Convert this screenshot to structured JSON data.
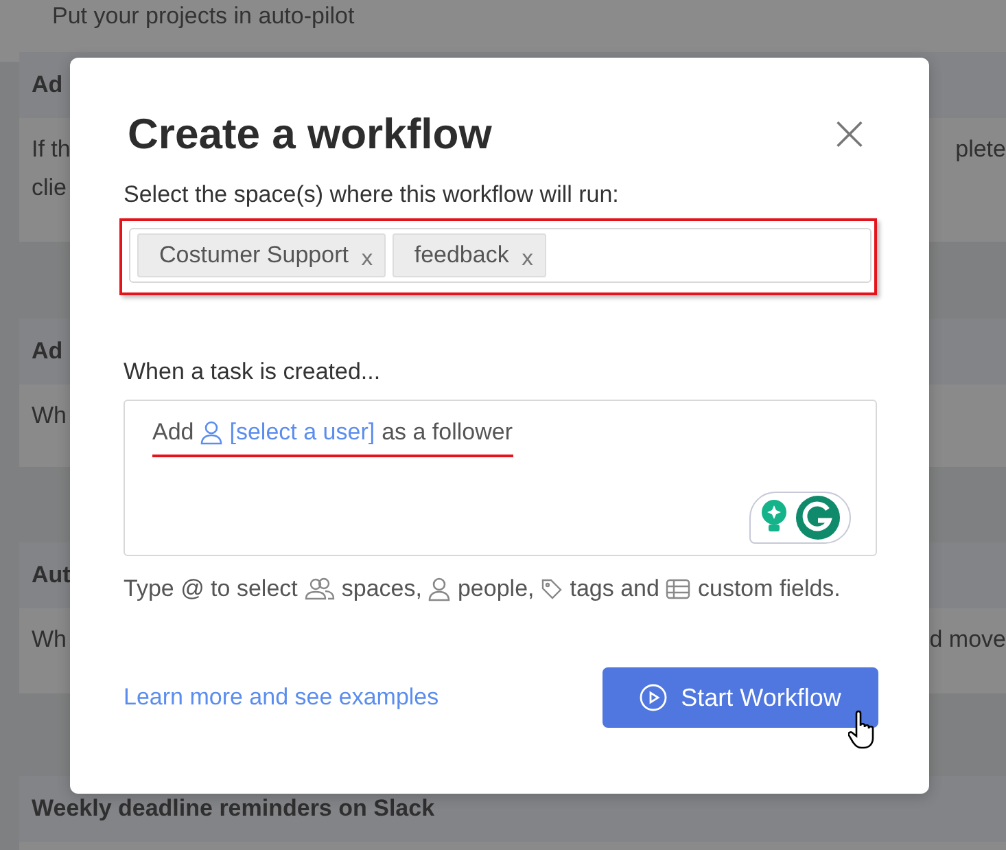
{
  "background": {
    "intro": "Put your projects in auto-pilot",
    "cards": [
      {
        "title": "Ad",
        "lines": [
          {
            "left": "If th",
            "right": "plete"
          },
          {
            "left": "clie"
          }
        ]
      },
      {
        "title": "Ad",
        "lines": [
          {
            "left": "Wh"
          }
        ]
      },
      {
        "title": "Aut",
        "lines": [
          {
            "left": "Wh",
            "right": "d move"
          }
        ]
      },
      {
        "title": "Weekly deadline reminders on Slack"
      }
    ]
  },
  "modal": {
    "title": "Create a workflow",
    "close": "×",
    "spaces_label": "Select the space(s) where this workflow will run:",
    "highlighted": true,
    "tags": [
      {
        "label": "Costumer Support",
        "remove": "x"
      },
      {
        "label": "feedback",
        "remove": "x"
      }
    ],
    "trigger_label": "When a task is created...",
    "editor": {
      "prefix": "Add",
      "user_link": "[select a user]",
      "suffix": "as a follower",
      "underlined": true
    },
    "hint": [
      {
        "kind": "plain",
        "text": "Type @ to select"
      },
      {
        "kind": "spaces",
        "text": "spaces,"
      },
      {
        "kind": "people",
        "text": "people,"
      },
      {
        "kind": "tags",
        "text": "tags and"
      },
      {
        "kind": "fields",
        "text": "custom fields."
      }
    ],
    "link": "Learn more and see examples",
    "button": "Start Workflow"
  }
}
